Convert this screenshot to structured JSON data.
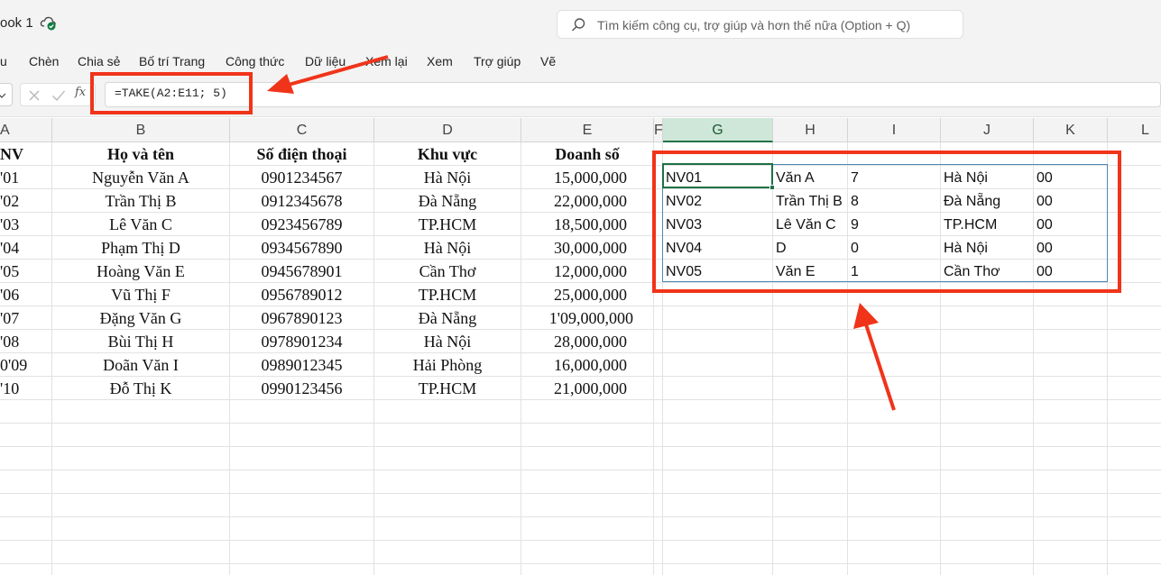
{
  "titlebar": {
    "workbook_title": "ook 1",
    "search_placeholder": "Tìm kiếm công cụ, trợ giúp và hơn thế nữa (Option + Q)"
  },
  "menu": {
    "items": [
      "u",
      "Chèn",
      "Chia sẻ",
      "Bố trí Trang",
      "Công thức",
      "Dữ liệu",
      "Xem lại",
      "Xem",
      "Trợ giúp",
      "Vẽ"
    ]
  },
  "formula_bar": {
    "fx_label": "fx",
    "formula": "=TAKE(A2:E11; 5)"
  },
  "columns": [
    "A",
    "B",
    "C",
    "D",
    "E",
    "F",
    "G",
    "H",
    "I",
    "J",
    "K",
    "L"
  ],
  "active_column": "G",
  "source_table": {
    "headers": [
      "NV",
      "Họ và tên",
      "Số điện thoại",
      "Khu vực",
      "Doanh số"
    ],
    "rows": [
      [
        "'01",
        "Nguyễn Văn A",
        "0901234567",
        "Hà Nội",
        "15,000,000"
      ],
      [
        "'02",
        "Trần Thị B",
        "0912345678",
        "Đà Nẵng",
        "22,000,000"
      ],
      [
        "'03",
        "Lê Văn C",
        "0923456789",
        "TP.HCM",
        "18,500,000"
      ],
      [
        "'04",
        "Phạm Thị D",
        "0934567890",
        "Hà Nội",
        "30,000,000"
      ],
      [
        "'05",
        "Hoàng Văn E",
        "0945678901",
        "Cần Thơ",
        "12,000,000"
      ],
      [
        "'06",
        "Vũ Thị F",
        "0956789012",
        "TP.HCM",
        "25,000,000"
      ],
      [
        "'07",
        "Đặng Văn G",
        "0967890123",
        "Đà Nẵng",
        "1'09,000,000"
      ],
      [
        "'08",
        "Bùi Thị H",
        "0978901234",
        "Hà Nội",
        "28,000,000"
      ],
      [
        "0'09",
        "Doãn Văn I",
        "0989012345",
        "Hải Phòng",
        "16,000,000"
      ],
      [
        "'10",
        "Đỗ Thị K",
        "0990123456",
        "TP.HCM",
        "21,000,000"
      ]
    ]
  },
  "result_table": {
    "rows": [
      [
        "NV01",
        "Văn A",
        "7",
        "Hà Nội",
        "00"
      ],
      [
        "NV02",
        "Trần Thị B",
        "8",
        "Đà Nẵng",
        "00"
      ],
      [
        "NV03",
        "Lê Văn C",
        "9",
        "TP.HCM",
        "00"
      ],
      [
        "NV04",
        "D",
        "0",
        "Hà Nội",
        "00"
      ],
      [
        "NV05",
        "Văn E",
        "1",
        "Cần Thơ",
        "00"
      ]
    ]
  },
  "annotation_color": "#f0341a",
  "accent_green": "#217346"
}
